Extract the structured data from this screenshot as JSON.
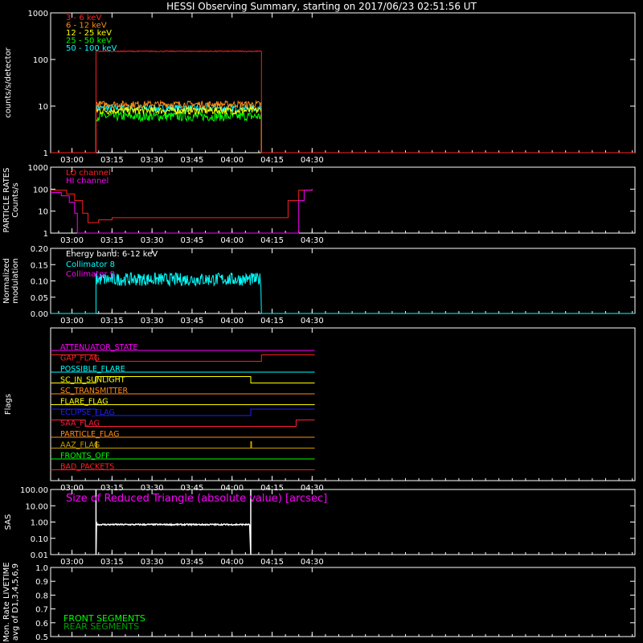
{
  "title": "HESSI Observing Summary, starting on 2017/06/23 02:51:56 UT",
  "time_ticks": [
    "03:00",
    "03:15",
    "03:30",
    "03:45",
    "04:00",
    "04:15",
    "04:30"
  ],
  "colors": {
    "red": "#ff2020",
    "orange": "#ff8c1a",
    "yellow": "#ffff00",
    "green": "#00ff00",
    "cyan": "#00ffff",
    "magenta": "#ff00ff",
    "crimson": "#ff1e3c",
    "blue": "#1e1eff",
    "olive": "#c8a000",
    "white": "#ffffff"
  },
  "chart_data": [
    {
      "type": "line",
      "ylabel": "counts/s/detector",
      "yscale": "log",
      "ylim": [
        1,
        1000
      ],
      "yticks": [
        "1",
        "10",
        "100",
        "1000"
      ],
      "series": [
        {
          "name": "3 - 6 keV",
          "color": "#ff2020",
          "level": 150,
          "start": "03:09",
          "end": "04:11"
        },
        {
          "name": "6 - 12 keV",
          "color": "#ff8c1a",
          "level": 11,
          "start": "03:09",
          "end": "04:11"
        },
        {
          "name": "12 - 25 keV",
          "color": "#ffff00",
          "level": 8,
          "start": "03:09",
          "end": "04:11"
        },
        {
          "name": "25 - 50 keV",
          "color": "#00ff00",
          "level": 6,
          "start": "03:09",
          "end": "04:11"
        },
        {
          "name": "50 - 100 keV",
          "color": "#00ffff",
          "level": 9,
          "start": "03:09",
          "end": "04:11"
        }
      ]
    },
    {
      "type": "line",
      "ylabel": "PARTICLE RATES Counts/s",
      "ylabel_lines": [
        "PARTICLE RATES",
        "Counts/s"
      ],
      "yscale": "log",
      "ylim": [
        1,
        1000
      ],
      "yticks": [
        "1",
        "10",
        "100",
        "1000"
      ],
      "series": [
        {
          "name": "LO channel",
          "color": "#ff2020",
          "points": [
            [
              "02:52",
              90
            ],
            [
              "02:58",
              60
            ],
            [
              "03:01",
              30
            ],
            [
              "03:04",
              8
            ],
            [
              "03:06",
              3
            ],
            [
              "03:08",
              3
            ],
            [
              "03:10",
              4
            ],
            [
              "03:15",
              5
            ],
            [
              "03:30",
              5
            ],
            [
              "03:45",
              5
            ],
            [
              "04:00",
              5
            ],
            [
              "04:10",
              5
            ],
            [
              "04:17",
              5
            ],
            [
              "04:21",
              30
            ],
            [
              "04:25",
              90
            ],
            [
              "04:30",
              100
            ]
          ]
        },
        {
          "name": "HI channel",
          "color": "#ff00ff",
          "points": [
            [
              "02:52",
              70
            ],
            [
              "02:56",
              50
            ],
            [
              "02:59",
              25
            ],
            [
              "03:01",
              8
            ],
            [
              "03:02",
              1
            ],
            [
              "04:24",
              1
            ],
            [
              "04:25",
              30
            ],
            [
              "04:27",
              90
            ],
            [
              "04:30",
              100
            ]
          ]
        }
      ]
    },
    {
      "type": "line",
      "ylabel": "Normalized modulation",
      "ylabel_lines": [
        "Normalized",
        "modulation"
      ],
      "ylim": [
        0,
        0.2
      ],
      "yticks": [
        "0.00",
        "0.05",
        "0.10",
        "0.15",
        "0.20"
      ],
      "annotation": "Energy band: 6-12 keV",
      "series": [
        {
          "name": "Collimator 8",
          "color": "#00ffff",
          "level": 0.105,
          "start": "03:09",
          "end": "04:11"
        },
        {
          "name": "Collimator 9",
          "color": "#ff00ff"
        }
      ]
    },
    {
      "type": "timeline",
      "ylabel": "Flags",
      "flags": [
        {
          "name": "ATTENUATOR_STATE",
          "color": "#ff00ff",
          "segments": [
            [
              "02:52",
              "04:31",
              0
            ]
          ]
        },
        {
          "name": "GAP_FLAG",
          "color": "#ff2020",
          "segments": [
            [
              "02:52",
              "03:09",
              1
            ],
            [
              "03:09",
              "04:11",
              0
            ],
            [
              "04:11",
              "04:31",
              1
            ]
          ]
        },
        {
          "name": "POSSIBLE_FLARE",
          "color": "#00ffff",
          "segments": [
            [
              "02:52",
              "04:31",
              0
            ]
          ]
        },
        {
          "name": "SC_IN_SUNLIGHT",
          "color": "#ffff00",
          "segments": [
            [
              "02:52",
              "03:09",
              0
            ],
            [
              "03:09",
              "04:07",
              1
            ],
            [
              "04:07",
              "04:31",
              0
            ]
          ]
        },
        {
          "name": "SC_TRANSMITTER",
          "color": "#ff8c1a",
          "segments": [
            [
              "02:52",
              "04:31",
              0
            ]
          ]
        },
        {
          "name": "FLARE_FLAG",
          "color": "#ffff00",
          "segments": [
            [
              "02:52",
              "04:31",
              0
            ]
          ]
        },
        {
          "name": "ECLIPSE_FLAG",
          "color": "#1e1eff",
          "segments": [
            [
              "02:52",
              "03:09",
              1
            ],
            [
              "03:09",
              "04:07",
              0
            ],
            [
              "04:07",
              "04:31",
              1
            ]
          ]
        },
        {
          "name": "SAA_FLAG",
          "color": "#ff1e3c",
          "segments": [
            [
              "02:52",
              "03:05",
              1
            ],
            [
              "03:05",
              "04:24",
              0
            ],
            [
              "04:24",
              "04:31",
              1
            ]
          ]
        },
        {
          "name": "PARTICLE_FLAG",
          "color": "#ff8c1a",
          "segments": [
            [
              "02:52",
              "04:31",
              0
            ]
          ]
        },
        {
          "name": "AAZ_FLAG",
          "color": "#c8a000",
          "segments": [
            [
              "02:52",
              "03:09",
              0
            ],
            [
              "03:09",
              "03:09.3",
              1
            ],
            [
              "03:09.3",
              "04:07",
              0
            ],
            [
              "04:07",
              "04:07.3",
              1
            ],
            [
              "04:07.3",
              "04:31",
              0
            ]
          ]
        },
        {
          "name": "FRONTS_OFF",
          "color": "#00ff00",
          "segments": [
            [
              "02:52",
              "04:31",
              0
            ]
          ]
        },
        {
          "name": "BAD_PACKETS",
          "color": "#ff2020",
          "segments": [
            [
              "02:52",
              "04:31",
              0
            ]
          ]
        }
      ]
    },
    {
      "type": "line",
      "ylabel": "SAS",
      "yscale": "log",
      "ylim": [
        0.01,
        100
      ],
      "yticks": [
        "0.01",
        "0.10",
        "1.00",
        "10.00",
        "100.00"
      ],
      "annotation": "Size of Reduced Triangle (absolute value) [arcsec]",
      "series": [
        {
          "color": "#ffffff",
          "level": 0.7,
          "start": "03:09",
          "end": "04:07"
        }
      ]
    },
    {
      "type": "line",
      "ylabel": "Mon. Rate LIVETIME avg of D1,3,4,5,6,9",
      "ylabel_lines": [
        "Mon. Rate LIVETIME",
        "avg of D1,3,4,5,6,9"
      ],
      "ylim": [
        0.5,
        1.0
      ],
      "yticks": [
        "0.5",
        "0.6",
        "0.7",
        "0.8",
        "0.9",
        "1.0"
      ],
      "series": [
        {
          "name": "FRONT SEGMENTS",
          "color": "#00ff00"
        },
        {
          "name": "REAR SEGMENTS",
          "color": "#00a000"
        }
      ]
    }
  ]
}
